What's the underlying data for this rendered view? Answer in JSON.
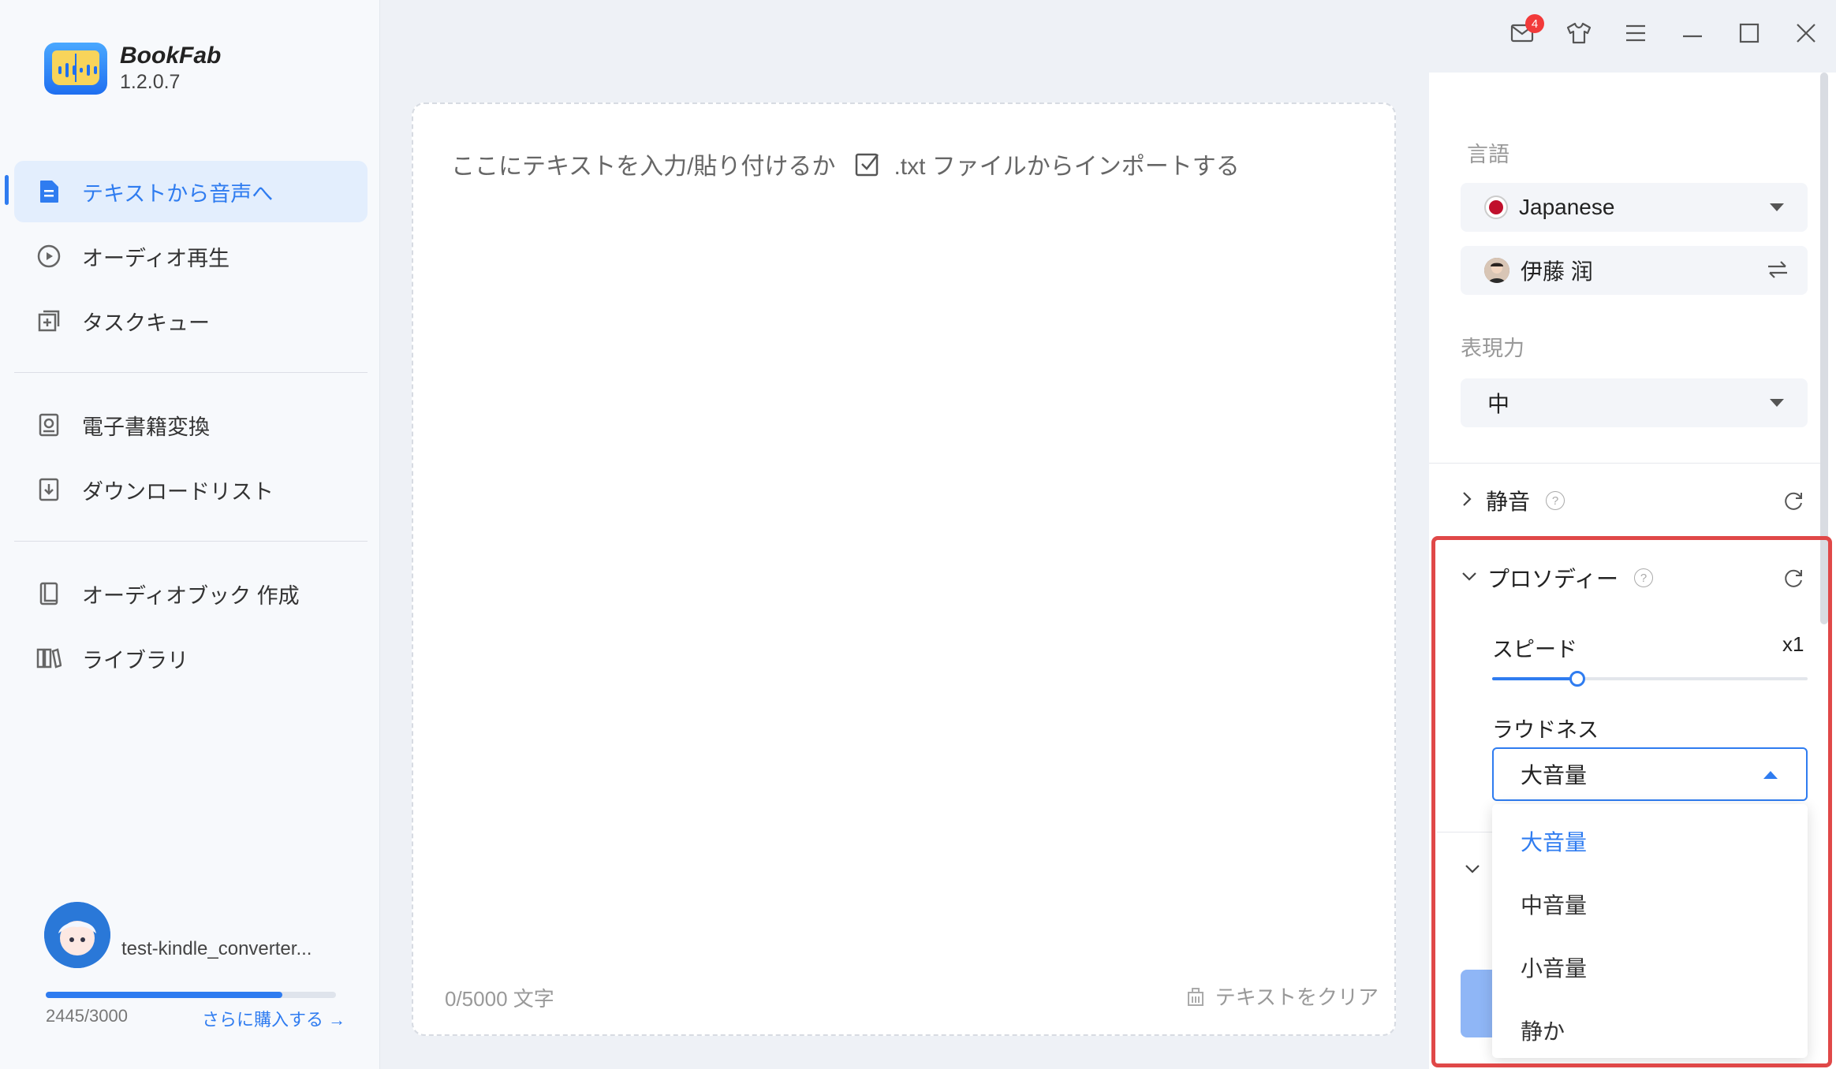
{
  "app": {
    "name": "BookFab",
    "version": "1.2.0.7"
  },
  "titlebar": {
    "mail_badge": "4"
  },
  "nav": {
    "items": [
      {
        "label": "テキストから音声へ",
        "icon": "document-icon"
      },
      {
        "label": "オーディオ再生",
        "icon": "play-circle-icon"
      },
      {
        "label": "タスクキュー",
        "icon": "queue-icon"
      },
      {
        "label": "電子書籍変換",
        "icon": "ebook-icon"
      },
      {
        "label": "ダウンロードリスト",
        "icon": "download-icon"
      },
      {
        "label": "オーディオブック 作成",
        "icon": "audiobook-icon"
      },
      {
        "label": "ライブラリ",
        "icon": "library-icon"
      }
    ],
    "active_index": 0
  },
  "user": {
    "name": "test-kindle_converter...",
    "quota_text": "2445/3000",
    "quota_fraction": 0.815,
    "buy_label": "さらに購入する →"
  },
  "editor": {
    "placeholder_prefix": "ここにテキストを入力/貼り付けるか",
    "placeholder_import": ".txt ファイルからインポートする",
    "char_count": "0/5000 文字",
    "clear_label": "テキストをクリア"
  },
  "settings": {
    "language_label": "言語",
    "language_value": "Japanese",
    "voice_value": "伊藤 润",
    "expressiveness_label": "表現力",
    "expressiveness_value": "中",
    "silence_title": "静音",
    "prosody_title": "プロソディー",
    "speed_label": "スピード",
    "speed_value": "x1",
    "speed_fraction": 0.27,
    "loudness_label": "ラウドネス",
    "loudness_value": "大音量",
    "loudness_options": [
      "大音量",
      "中音量",
      "小音量",
      "静か"
    ],
    "loudness_selected_index": 0
  },
  "colors": {
    "accent": "#2f7cf0",
    "highlight": "#e04848"
  }
}
